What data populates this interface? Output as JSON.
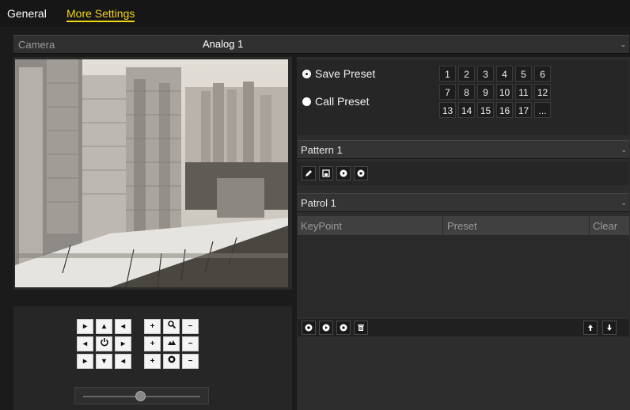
{
  "tabs": {
    "general": "General",
    "more": "More Settings"
  },
  "camera": {
    "label": "Camera",
    "value": "Analog 1"
  },
  "preset": {
    "save_label": "Save Preset",
    "call_label": "Call Preset",
    "numbers": [
      "1",
      "2",
      "3",
      "4",
      "5",
      "6",
      "7",
      "8",
      "9",
      "10",
      "11",
      "12",
      "13",
      "14",
      "15",
      "16",
      "17",
      "..."
    ]
  },
  "pattern": {
    "value": "Pattern 1"
  },
  "patrol": {
    "value": "Patrol 1",
    "columns": [
      "KeyPoint",
      "Preset",
      "Clear"
    ]
  },
  "ptz": {
    "rows": [
      [
        "▸",
        "▴",
        "◂",
        "+",
        "zoom-icon",
        "−"
      ],
      [
        "◂",
        "power-icon",
        "▸",
        "+",
        "focus-icon",
        "−"
      ],
      [
        "▸",
        "▾",
        "◂",
        "+",
        "iris-icon",
        "−"
      ]
    ]
  },
  "colors": {
    "accent": "#f4d417",
    "bg": "#1b1b1b"
  }
}
